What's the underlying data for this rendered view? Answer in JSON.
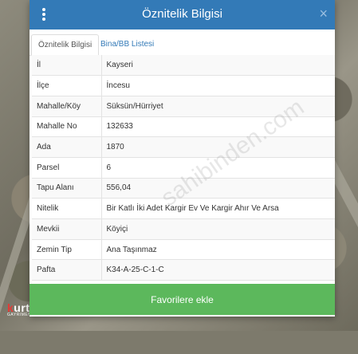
{
  "header": {
    "title": "Öznitelik Bilgisi",
    "close_glyph": "×"
  },
  "tabs": [
    {
      "label": "Öznitelik Bilgisi",
      "active": true
    },
    {
      "label": "Bina/BB Listesi",
      "active": false
    }
  ],
  "attributes": [
    {
      "key": "İl",
      "value": "Kayseri"
    },
    {
      "key": "İlçe",
      "value": "İncesu"
    },
    {
      "key": "Mahalle/Köy",
      "value": "Süksün/Hürriyet"
    },
    {
      "key": "Mahalle No",
      "value": "132633"
    },
    {
      "key": "Ada",
      "value": "1870"
    },
    {
      "key": "Parsel",
      "value": "6"
    },
    {
      "key": "Tapu Alanı",
      "value": "556,04"
    },
    {
      "key": "Nitelik",
      "value": "Bir Katlı İki Adet Kargir Ev Ve Kargir Ahır Ve Arsa"
    },
    {
      "key": "Mevkii",
      "value": "Köyiçi"
    },
    {
      "key": "Zemin Tip",
      "value": "Ana Taşınmaz"
    },
    {
      "key": "Pafta",
      "value": "K34-A-25-C-1-C"
    }
  ],
  "favorite_button": "Favorilere ekle",
  "watermark": "sahibinden.com",
  "logo": {
    "name_prefix": "k",
    "name_rest": "urtsoy",
    "sub": "GAYRIMENKUL A.Ş"
  },
  "colors": {
    "header": "#337ab7",
    "button": "#5cb85c"
  }
}
